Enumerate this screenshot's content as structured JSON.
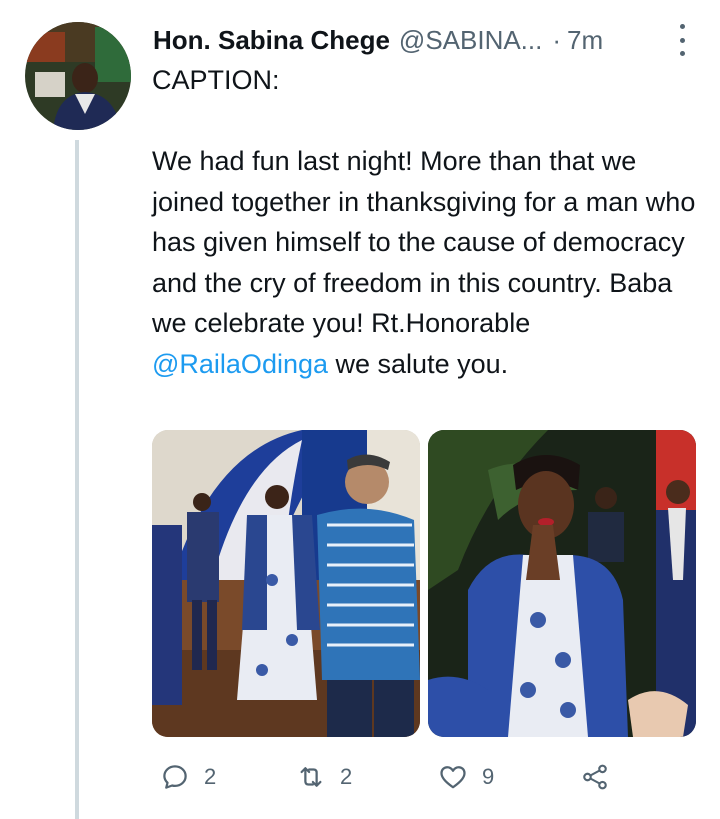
{
  "tweet": {
    "author_name": "Hon. Sabina Chege",
    "author_handle": "@SABINA...",
    "separator": "·",
    "timestamp": "7m",
    "text_line1": "CAPTION:",
    "text_body_before_mention": "We had fun last night! More than that we joined together in thanksgiving for a man who has given himself to the cause of democracy and the cry of freedom in this country. Baba we celebrate you! Rt.Honorable ",
    "mention": "@RailaOdinga",
    "text_body_after_mention": " we salute you."
  },
  "actions": {
    "reply_count": "2",
    "retweet_count": "2",
    "like_count": "9"
  },
  "icons": {
    "reply": "reply-icon",
    "retweet": "retweet-icon",
    "like": "heart-icon",
    "share": "share-icon",
    "more": "more-vertical-icon"
  },
  "colors": {
    "link": "#1d9bf0",
    "secondary_text": "#536471",
    "thread_line": "#cfd9de"
  }
}
